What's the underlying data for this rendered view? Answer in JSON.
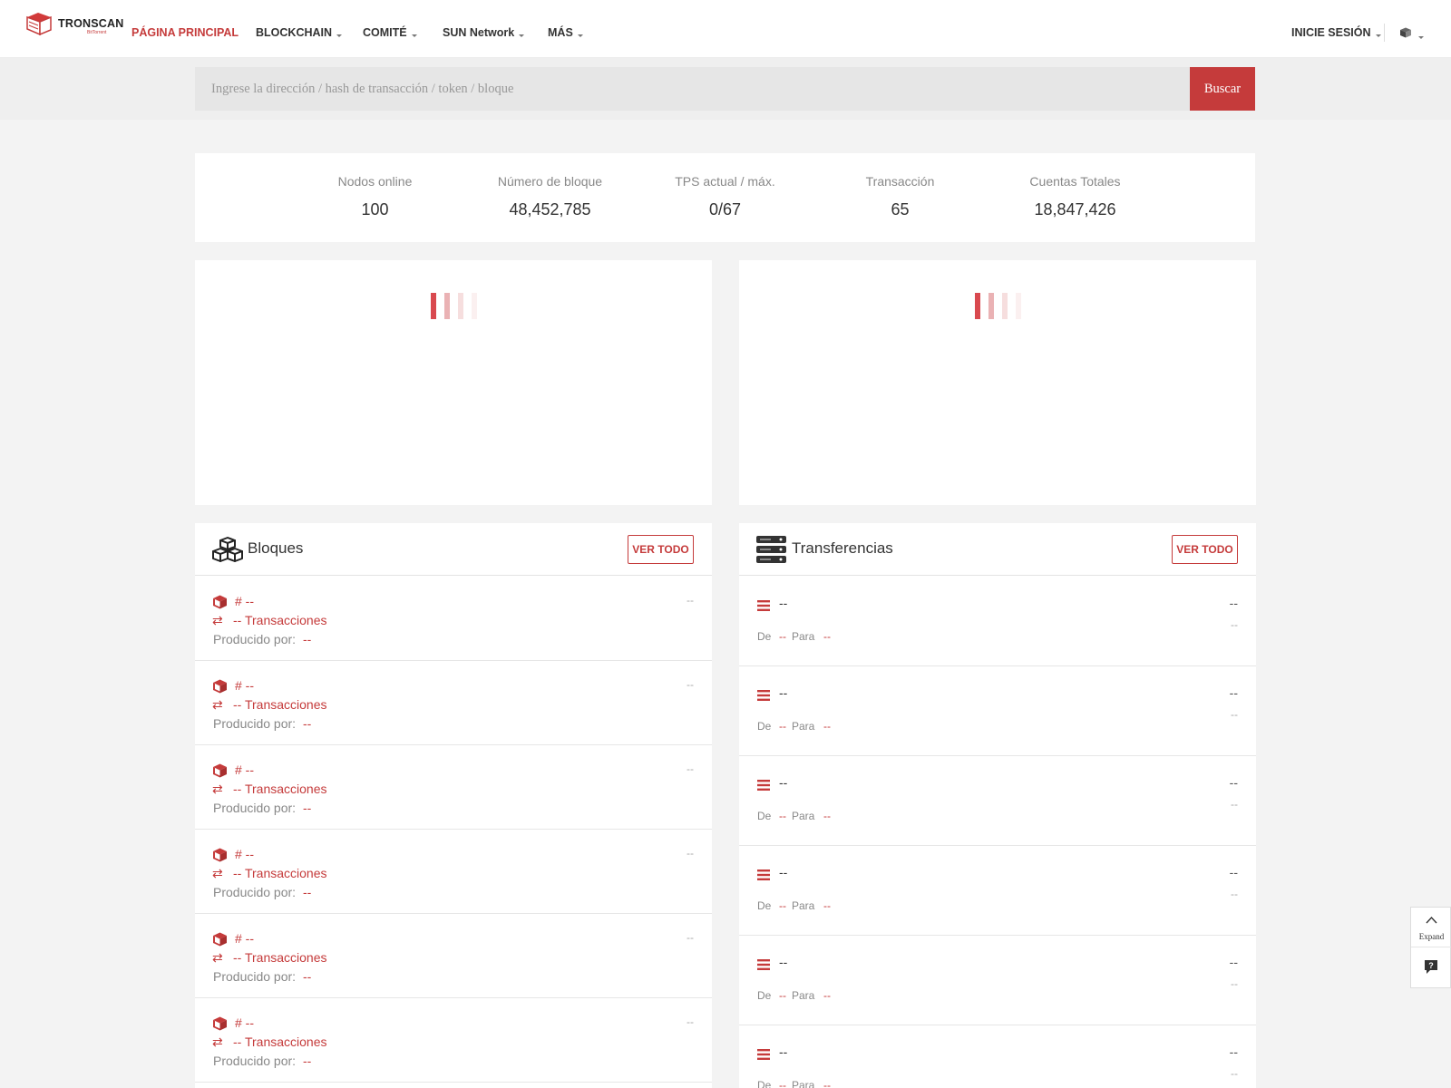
{
  "brand": {
    "name": "TRONSCAN",
    "tagline": "BitTorrent"
  },
  "nav": {
    "items": [
      {
        "label": "PÁGINA PRINCIPAL",
        "active": true,
        "dropdown": false
      },
      {
        "label": "BLOCKCHAIN",
        "active": false,
        "dropdown": true
      },
      {
        "label": "COMITÉ",
        "active": false,
        "dropdown": true
      },
      {
        "label": "SUN Network",
        "active": false,
        "dropdown": true
      },
      {
        "label": "MÁS",
        "active": false,
        "dropdown": true
      }
    ],
    "login": "INICIE SESIÓN",
    "language_icon": "language-cube-icon"
  },
  "search": {
    "placeholder": "Ingrese la dirección / hash de transacción / token / bloque",
    "button": "Buscar"
  },
  "stats": [
    {
      "label": "Nodos online",
      "value": "100"
    },
    {
      "label": "Número de bloque",
      "value": "48,452,785"
    },
    {
      "label": "TPS actual / máx.",
      "value": "0/67"
    },
    {
      "label": "Transacción",
      "value": "65"
    },
    {
      "label": "Cuentas Totales",
      "value": "18,847,426"
    }
  ],
  "blocks": {
    "title": "Bloques",
    "view_all": "VER TODO",
    "rows": [
      {
        "number": "# --",
        "tx": "-- Transacciones",
        "produced_label": "Producido por:",
        "produced_by": "--",
        "time": "--"
      },
      {
        "number": "# --",
        "tx": "-- Transacciones",
        "produced_label": "Producido por:",
        "produced_by": "--",
        "time": "--"
      },
      {
        "number": "# --",
        "tx": "-- Transacciones",
        "produced_label": "Producido por:",
        "produced_by": "--",
        "time": "--"
      },
      {
        "number": "# --",
        "tx": "-- Transacciones",
        "produced_label": "Producido por:",
        "produced_by": "--",
        "time": "--"
      },
      {
        "number": "# --",
        "tx": "-- Transacciones",
        "produced_label": "Producido por:",
        "produced_by": "--",
        "time": "--"
      },
      {
        "number": "# --",
        "tx": "-- Transacciones",
        "produced_label": "Producido por:",
        "produced_by": "--",
        "time": "--"
      }
    ]
  },
  "transfers": {
    "title": "Transferencias",
    "view_all": "VER TODO",
    "rows": [
      {
        "amount": "--",
        "from_label": "De",
        "from": "--",
        "to_label": "Para",
        "to": "--",
        "right_top": "--",
        "right_bottom": "--"
      },
      {
        "amount": "--",
        "from_label": "De",
        "from": "--",
        "to_label": "Para",
        "to": "--",
        "right_top": "--",
        "right_bottom": "--"
      },
      {
        "amount": "--",
        "from_label": "De",
        "from": "--",
        "to_label": "Para",
        "to": "--",
        "right_top": "--",
        "right_bottom": "--"
      },
      {
        "amount": "--",
        "from_label": "De",
        "from": "--",
        "to_label": "Para",
        "to": "--",
        "right_top": "--",
        "right_bottom": "--"
      },
      {
        "amount": "--",
        "from_label": "De",
        "from": "--",
        "to_label": "Para",
        "to": "--",
        "right_top": "--",
        "right_bottom": "--"
      },
      {
        "amount": "--",
        "from_label": "De",
        "from": "--",
        "to_label": "Para",
        "to": "--",
        "right_top": "--",
        "right_bottom": "--"
      }
    ]
  },
  "float": {
    "expand": "Expand",
    "help_icon": "help-icon"
  },
  "colors": {
    "accent": "#c53b3b",
    "background": "#f3f3f3",
    "panel": "#ffffff"
  }
}
